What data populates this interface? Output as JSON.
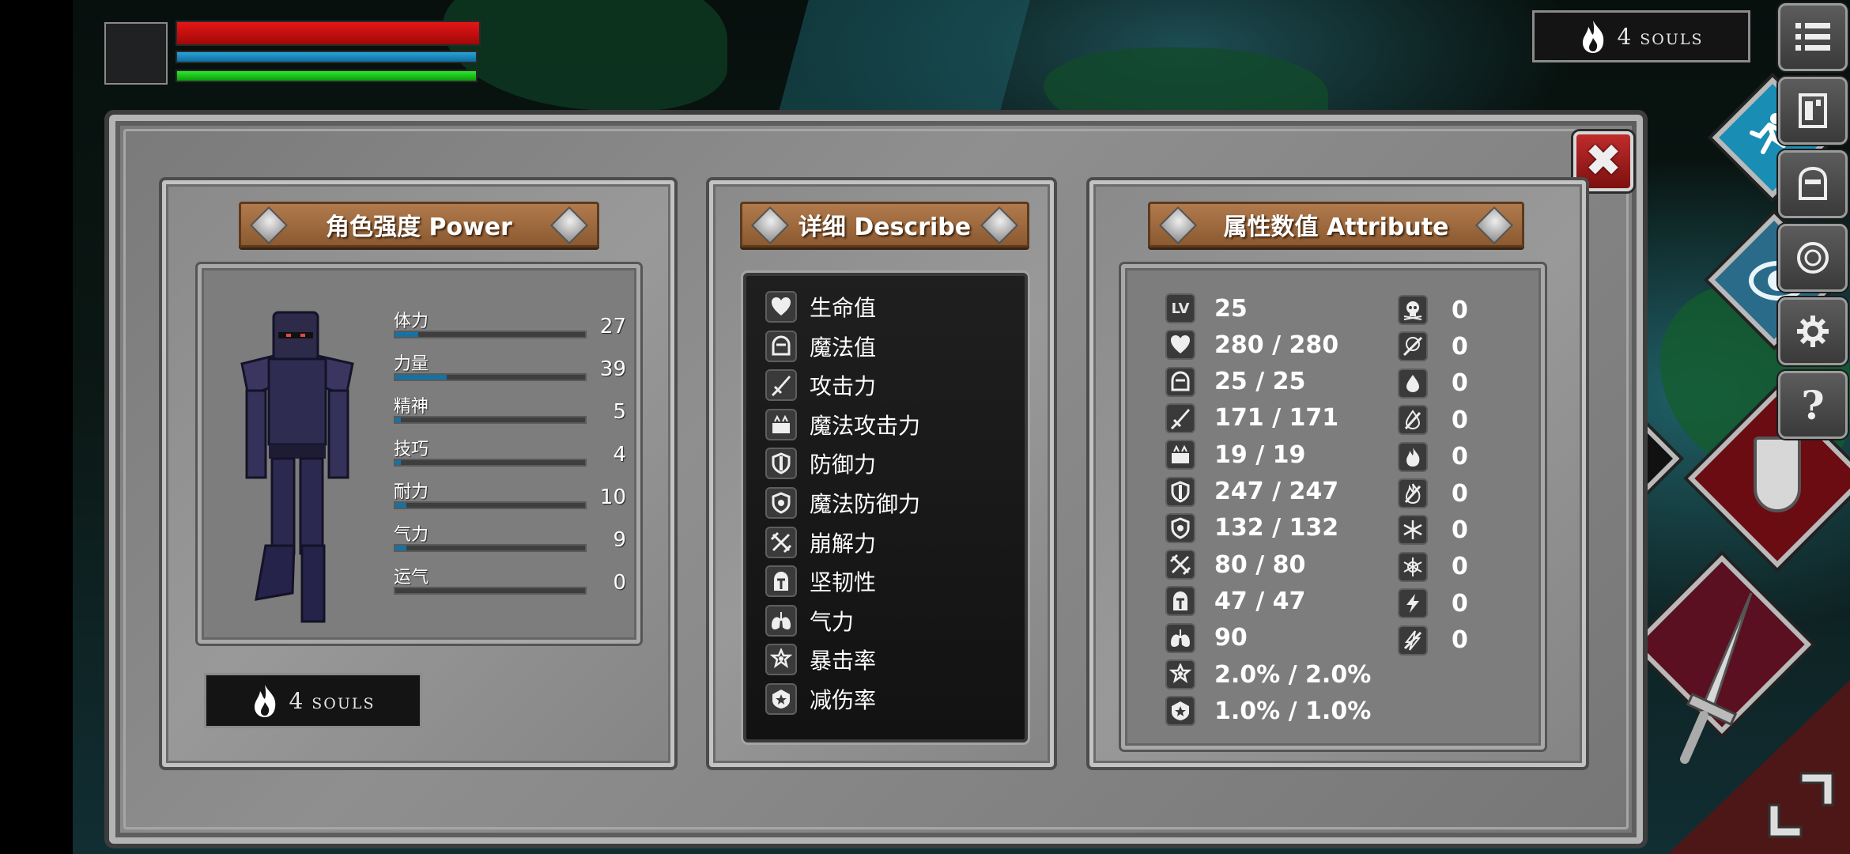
{
  "hud": {
    "souls_count": "4",
    "souls_unit": "SOULS",
    "hp_fill": 1.0,
    "mp_fill": 1.0,
    "stamina_fill": 1.0
  },
  "window": {
    "close_icon": "close-x-icon"
  },
  "power_panel": {
    "title": "角色强度 Power",
    "stats": [
      {
        "label": "体力",
        "value": "27",
        "fill": 0.12
      },
      {
        "label": "力量",
        "value": "39",
        "fill": 0.27
      },
      {
        "label": "精神",
        "value": "5",
        "fill": 0.03
      },
      {
        "label": "技巧",
        "value": "4",
        "fill": 0.03
      },
      {
        "label": "耐力",
        "value": "10",
        "fill": 0.06
      },
      {
        "label": "气力",
        "value": "9",
        "fill": 0.06
      },
      {
        "label": "运气",
        "value": "0",
        "fill": 0.0
      }
    ],
    "souls_count": "4",
    "souls_unit": "SOULS"
  },
  "describe_panel": {
    "title": "详细 Describe",
    "items": [
      {
        "icon": "heart-icon",
        "label": "生命值"
      },
      {
        "icon": "helmet-mana-icon",
        "label": "魔法值"
      },
      {
        "icon": "sword-icon",
        "label": "攻击力"
      },
      {
        "icon": "magic-book-icon",
        "label": "魔法攻击力"
      },
      {
        "icon": "shield-icon",
        "label": "防御力"
      },
      {
        "icon": "magic-shield-icon",
        "label": "魔法防御力"
      },
      {
        "icon": "break-icon",
        "label": "崩解力"
      },
      {
        "icon": "knight-helmet-icon",
        "label": "坚韧性"
      },
      {
        "icon": "lungs-icon",
        "label": "气力"
      },
      {
        "icon": "critical-star-icon",
        "label": "暴击率"
      },
      {
        "icon": "damage-reduce-icon",
        "label": "减伤率"
      }
    ]
  },
  "attribute_panel": {
    "title": "属性数值 Attribute",
    "level_badge": "LV",
    "left_values": [
      {
        "icon": "level-icon",
        "value": "25"
      },
      {
        "icon": "heart-icon",
        "value": "280 / 280"
      },
      {
        "icon": "helmet-mana-icon",
        "value": "25 / 25"
      },
      {
        "icon": "sword-icon",
        "value": "171 / 171"
      },
      {
        "icon": "magic-book-icon",
        "value": "19 / 19"
      },
      {
        "icon": "shield-icon",
        "value": "247 / 247"
      },
      {
        "icon": "magic-shield-icon",
        "value": "132 / 132"
      },
      {
        "icon": "break-icon",
        "value": "80 / 80"
      },
      {
        "icon": "knight-helmet-icon",
        "value": "47 / 47"
      },
      {
        "icon": "lungs-icon",
        "value": "90"
      },
      {
        "icon": "critical-star-icon",
        "value": "2.0% / 2.0%"
      },
      {
        "icon": "damage-reduce-icon",
        "value": "1.0% / 1.0%"
      }
    ],
    "right_values": [
      {
        "icon": "skull-icon",
        "value": "0"
      },
      {
        "icon": "skull-resist-icon",
        "value": "0"
      },
      {
        "icon": "water-drop-icon",
        "value": "0"
      },
      {
        "icon": "water-resist-icon",
        "value": "0"
      },
      {
        "icon": "fire-icon",
        "value": "0"
      },
      {
        "icon": "fire-resist-icon",
        "value": "0"
      },
      {
        "icon": "ice-icon",
        "value": "0"
      },
      {
        "icon": "ice-resist-icon",
        "value": "0"
      },
      {
        "icon": "lightning-icon",
        "value": "0"
      },
      {
        "icon": "lightning-resist-icon",
        "value": "0"
      }
    ]
  },
  "side_buttons": [
    {
      "icon": "menu-list-icon"
    },
    {
      "icon": "inventory-icon"
    },
    {
      "icon": "armor-helmet-icon"
    },
    {
      "icon": "skill-orb-icon"
    },
    {
      "icon": "settings-gear-icon"
    },
    {
      "icon": "help-question-icon"
    }
  ],
  "side_button_help": "?",
  "colors": {
    "hp": "#e51616",
    "mp": "#2ba2d6",
    "stamina": "#2ee82e",
    "plank": "#a06a3e",
    "stat_fill": "#1672a2",
    "close": "#c02b2b"
  }
}
